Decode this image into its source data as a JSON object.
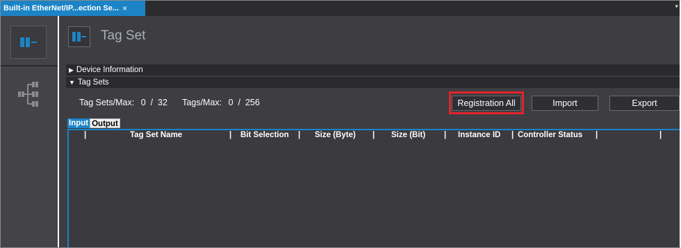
{
  "tab": {
    "title": "Built-in EtherNet/IP...ection Se...",
    "close": "×",
    "menu": "▾"
  },
  "page": {
    "title": "Tag Set"
  },
  "sections": {
    "device_info": {
      "arrow": "▶",
      "label": "Device Information"
    },
    "tag_sets": {
      "arrow": "▼",
      "label": "Tag Sets"
    }
  },
  "counts": {
    "tag_sets_label": "Tag Sets/Max:",
    "tag_sets_value": "0  /  32",
    "tags_label": "Tags/Max:",
    "tags_value": "0  /  256"
  },
  "buttons": {
    "registration_all": "Registration All",
    "import": "Import",
    "export": "Export"
  },
  "io_tabs": {
    "input": "Input",
    "output": "Output"
  },
  "table": {
    "separator": "|",
    "columns": [
      "Tag Set Name",
      "Bit Selection",
      "Size (Byte)",
      "Size (Bit)",
      "Instance ID",
      "Controller Status"
    ]
  },
  "colors": {
    "accent": "#1c84c6",
    "highlight": "#e4232b",
    "panel": "#3d3d42",
    "rail": "#434348"
  }
}
